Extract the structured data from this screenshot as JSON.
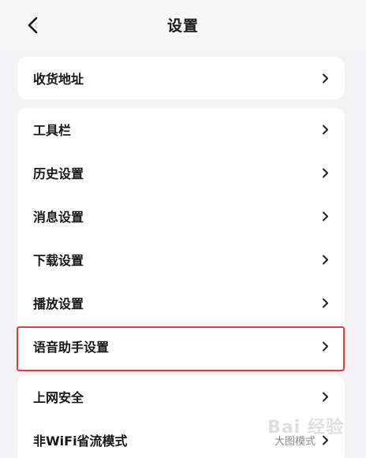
{
  "header": {
    "title": "设置",
    "back_icon": "chevron-left-icon"
  },
  "card1": {
    "items": [
      {
        "label": "收货地址"
      }
    ]
  },
  "card2": {
    "items": [
      {
        "label": "工具栏"
      },
      {
        "label": "历史设置"
      },
      {
        "label": "消息设置"
      },
      {
        "label": "下载设置"
      },
      {
        "label": "播放设置"
      },
      {
        "label": "语音助手设置"
      }
    ]
  },
  "card3": {
    "items": [
      {
        "label": "上网安全",
        "value": ""
      },
      {
        "label": "非WiFi省流模式",
        "value": "大图模式"
      }
    ]
  },
  "watermark": "Bai 经验",
  "colors": {
    "highlight": "#e23b3b",
    "background": "#f3f3f5",
    "card": "#ffffff"
  }
}
